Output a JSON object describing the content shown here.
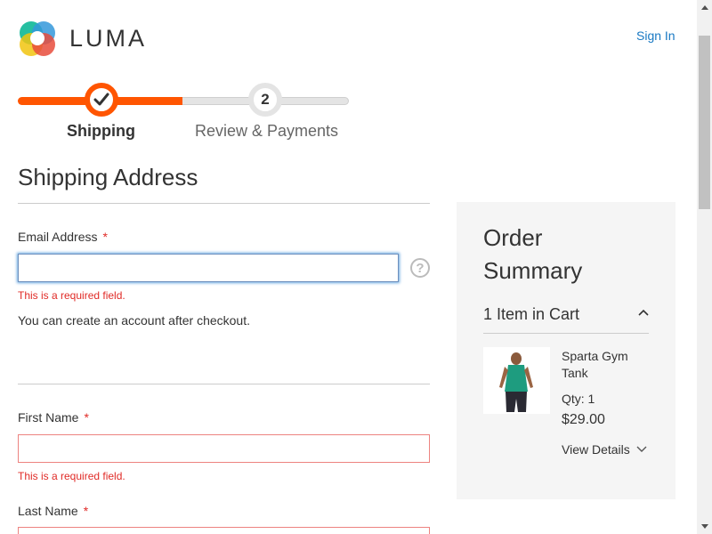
{
  "header": {
    "logo_text": "LUMA",
    "sign_in_label": "Sign In"
  },
  "progress": {
    "steps": [
      {
        "number": "",
        "label": "Shipping",
        "status": "active"
      },
      {
        "number": "2",
        "label": "Review & Payments",
        "status": "pending"
      }
    ]
  },
  "shipping": {
    "title": "Shipping Address",
    "email": {
      "label": "Email Address",
      "required_marker": "*",
      "value": "",
      "error": "This is a required field."
    },
    "account_note": "You can create an account after checkout.",
    "first_name": {
      "label": "First Name",
      "required_marker": "*",
      "value": "",
      "error": "This is a required field."
    },
    "last_name": {
      "label": "Last Name",
      "required_marker": "*",
      "value": ""
    },
    "help_icon": "?"
  },
  "order_summary": {
    "title": "Order Summary",
    "cart_count_text": "1 Item in Cart",
    "items": [
      {
        "name": "Sparta Gym Tank",
        "qty_text": "Qty: 1",
        "price": "$29.00",
        "view_details_label": "View Details"
      }
    ]
  },
  "colors": {
    "accent": "#ff5501",
    "link": "#1979c3",
    "error": "#e02b27",
    "sidebar_bg": "#f5f5f5"
  }
}
